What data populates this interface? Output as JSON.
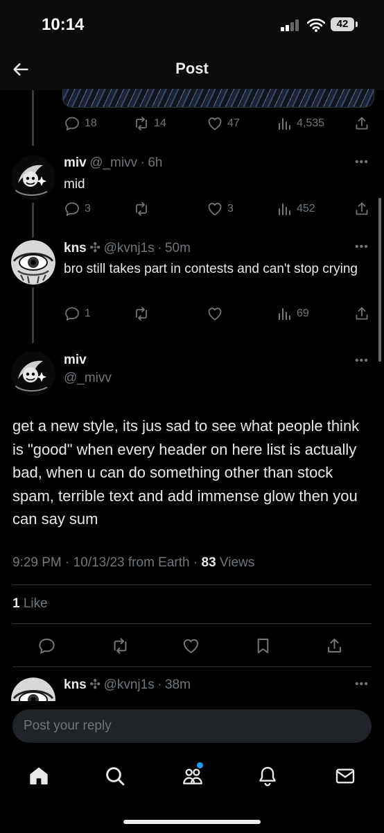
{
  "status_bar": {
    "time": "10:14",
    "battery": "42"
  },
  "header": {
    "title": "Post"
  },
  "quoted_post_actions": {
    "replies": "18",
    "views": "4,535",
    "likes": "47",
    "reposts": "14"
  },
  "replies": [
    {
      "name": "miv",
      "badge": "",
      "handle": "@_mivv",
      "sep": "·",
      "time": "6h",
      "text": "mid",
      "actions": {
        "replies": "3",
        "reposts": "",
        "likes": "3",
        "views": "452"
      }
    },
    {
      "name": "kns",
      "badge": "✣",
      "handle": "@kvnj1s",
      "sep": "·",
      "time": "50m",
      "text": "bro still takes part in contests and can't stop crying",
      "actions": {
        "replies": "1",
        "reposts": "",
        "likes": "",
        "views": "69"
      }
    }
  ],
  "main_post": {
    "name": "miv",
    "handle": "@_mivv",
    "text": "get a new style, its jus sad to see what people think is \"good\" when every header on here list is actually bad, when u can do something other than stock spam, terrible text and add immense glow then you can say sum",
    "time": "9:29 PM",
    "date": "10/13/23",
    "source": "from Earth",
    "views_count": "83",
    "views_label": "Views",
    "like_count": "1",
    "like_label": "Like"
  },
  "next_reply": {
    "name": "kns",
    "badge": "✣",
    "handle": "@kvnj1s",
    "sep": "·",
    "time": "38m"
  },
  "reply_input": {
    "placeholder": "Post your reply"
  },
  "icons": {
    "back": "arrow-left-icon",
    "reply": "speech-bubble-icon",
    "repost": "repost-icon",
    "like": "heart-icon",
    "views": "bar-chart-icon",
    "share": "share-icon",
    "bookmark": "bookmark-icon",
    "home": "home-icon",
    "search": "search-icon",
    "communities": "people-icon",
    "notifications": "bell-icon",
    "messages": "envelope-icon"
  },
  "colors": {
    "background": "#000000",
    "text": "#e7e9ea",
    "muted": "#71767b",
    "accent": "#1d9bf0",
    "divider": "#2f3336"
  }
}
